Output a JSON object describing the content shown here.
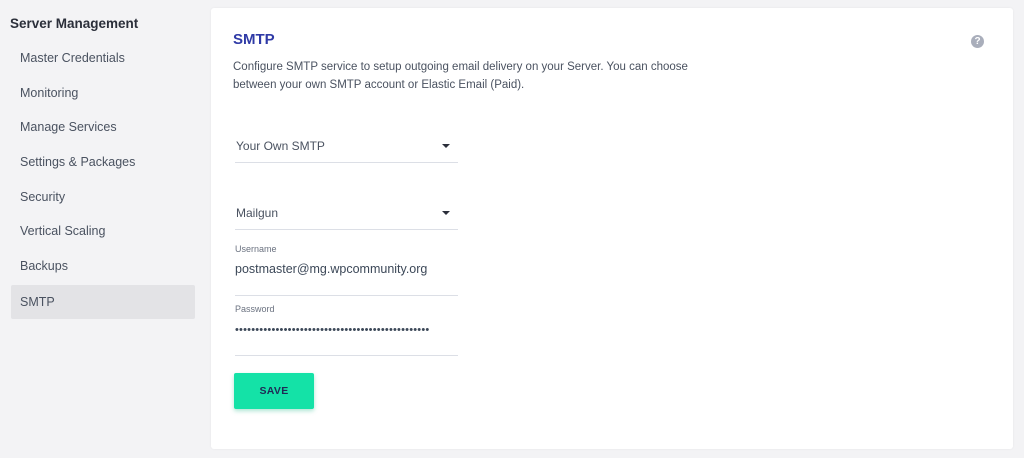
{
  "sidebar": {
    "title": "Server Management",
    "items": [
      {
        "label": "Master Credentials"
      },
      {
        "label": "Monitoring"
      },
      {
        "label": "Manage Services"
      },
      {
        "label": "Settings & Packages"
      },
      {
        "label": "Security"
      },
      {
        "label": "Vertical Scaling"
      },
      {
        "label": "Backups"
      },
      {
        "label": "SMTP"
      }
    ],
    "active": "SMTP"
  },
  "main": {
    "title": "SMTP",
    "help_icon": "question-circle-icon",
    "description_line1": "Configure SMTP service to setup outgoing email delivery on your Server. You can choose",
    "description_line2": "between your own SMTP account or Elastic Email (Paid).",
    "smtp_type_select": {
      "value": "Your Own SMTP"
    },
    "provider_select": {
      "value": "Mailgun"
    },
    "username": {
      "label": "Username",
      "value": "postmaster@mg.wpcommunity.org"
    },
    "password": {
      "label": "Password",
      "value": "••••••••••••••••••••••••••••••••••••••••••••••••"
    },
    "save_label": "SAVE"
  },
  "colors": {
    "accent_button": "#14e2a7",
    "title_color": "#2f3aa6",
    "active_item_bg": "#e3e3e6"
  }
}
